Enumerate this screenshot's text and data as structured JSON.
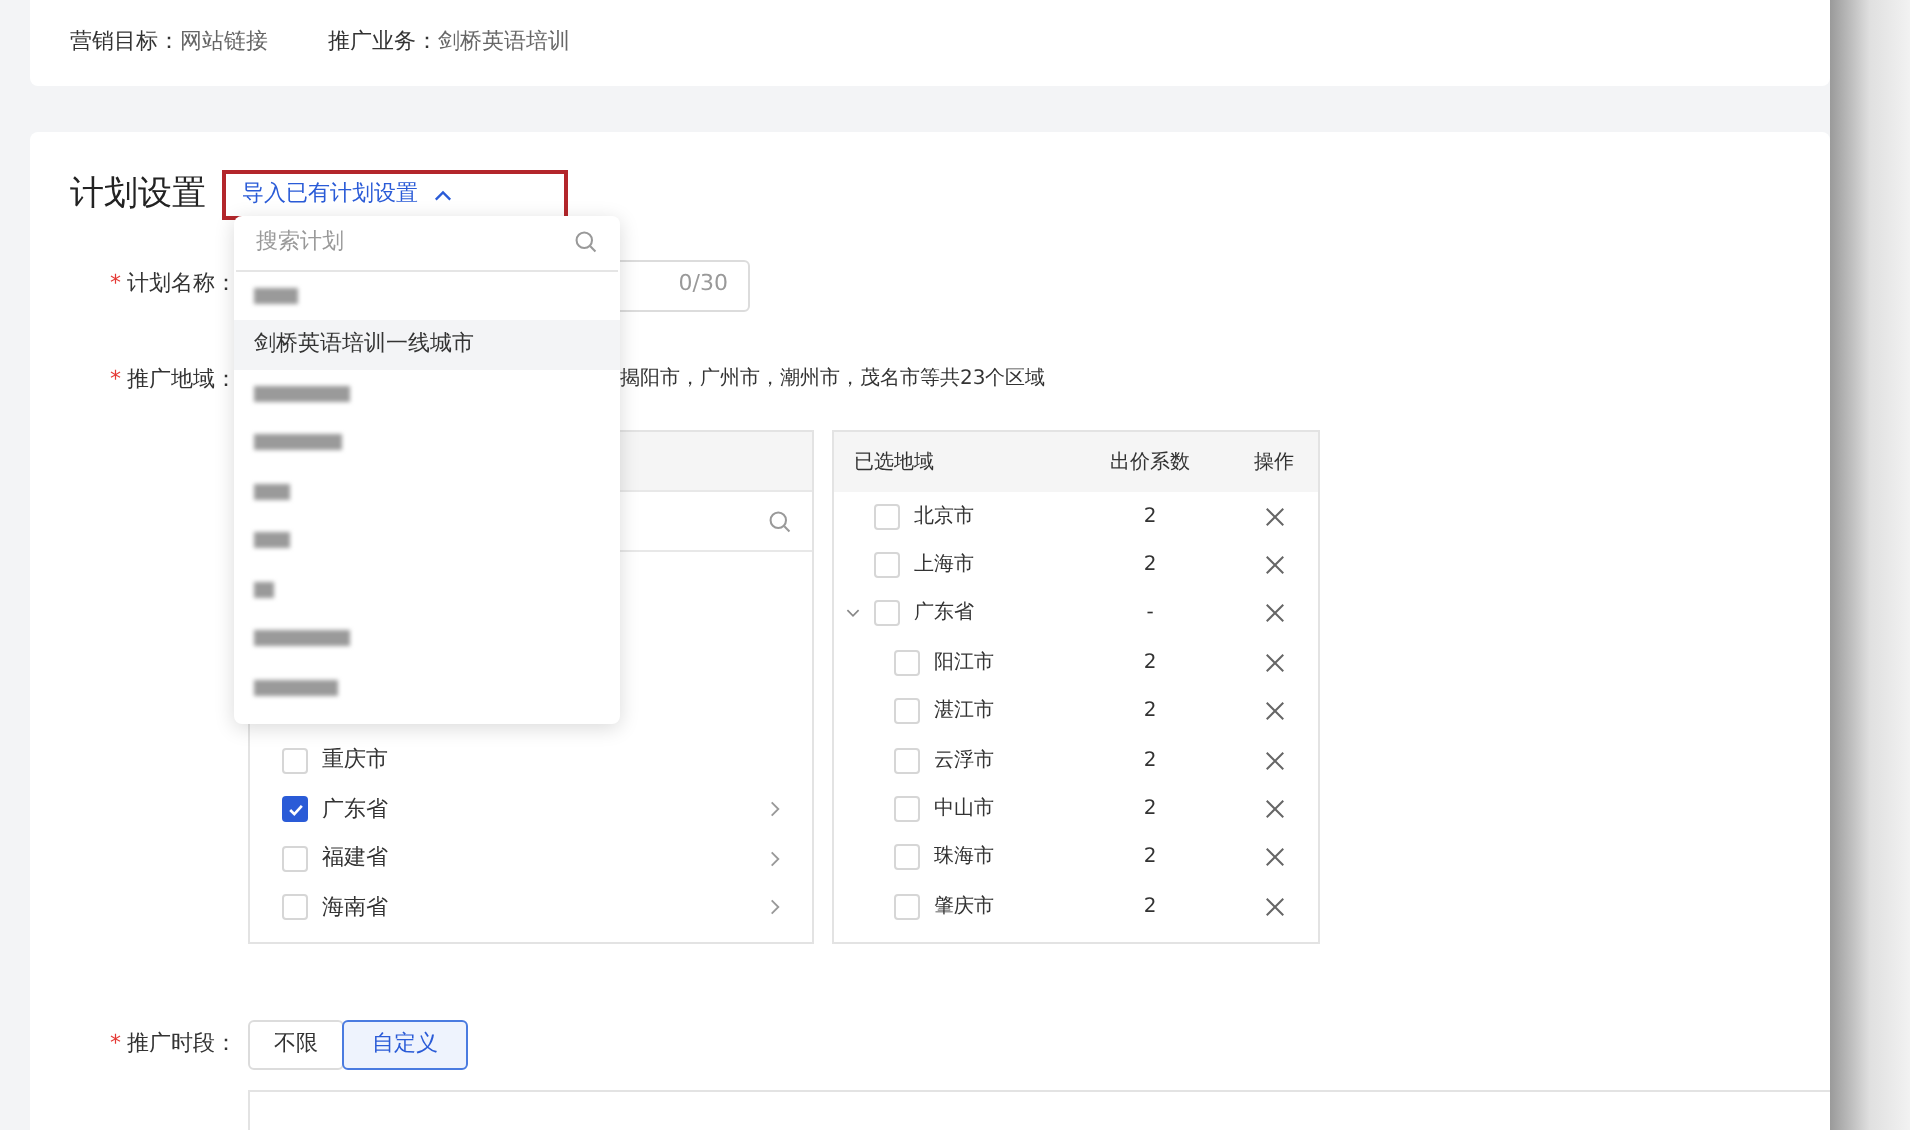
{
  "summary": [
    {
      "label": "营销目标：",
      "value": "网站链接"
    },
    {
      "label": "推广业务：",
      "value": "剑桥英语培训"
    }
  ],
  "plan_settings": {
    "title": "计划设置",
    "import_link": {
      "label": "导入已有计划设置",
      "expanded": true
    }
  },
  "import_dropdown": {
    "search": {
      "placeholder": "搜索计划"
    },
    "items": [
      {
        "kind": "redacted",
        "highlighted": false
      },
      {
        "kind": "text",
        "label": "剑桥英语培训一线城市",
        "highlighted": true
      },
      {
        "kind": "redacted",
        "highlighted": false
      },
      {
        "kind": "redacted",
        "highlighted": false
      },
      {
        "kind": "redacted",
        "highlighted": false
      },
      {
        "kind": "redacted",
        "highlighted": false
      },
      {
        "kind": "redacted",
        "highlighted": false
      },
      {
        "kind": "redacted",
        "highlighted": false
      },
      {
        "kind": "redacted",
        "highlighted": false
      }
    ]
  },
  "plan_name": {
    "required_mark": "*",
    "label": "计划名称：",
    "counter": "0/30"
  },
  "region": {
    "required_mark": "*",
    "label": "推广地域：",
    "summary": "揭阳市，广州市，潮州市，茂名市等共23个区域",
    "available": {
      "items": [
        {
          "label": "重庆市",
          "checked": false,
          "has_children": false
        },
        {
          "label": "广东省",
          "checked": true,
          "has_children": true
        },
        {
          "label": "福建省",
          "checked": false,
          "has_children": true
        },
        {
          "label": "海南省",
          "checked": false,
          "has_children": true
        }
      ]
    },
    "selected": {
      "columns": [
        "已选地域",
        "出价系数",
        "操作"
      ],
      "rows": [
        {
          "label": "北京市",
          "bid": "2",
          "checked": false
        },
        {
          "label": "上海市",
          "bid": "2",
          "checked": false
        },
        {
          "label": "广东省",
          "bid": "-",
          "checked": false,
          "expanded": true,
          "children": [
            {
              "label": "阳江市",
              "bid": "2",
              "checked": false
            },
            {
              "label": "湛江市",
              "bid": "2",
              "checked": false
            },
            {
              "label": "云浮市",
              "bid": "2",
              "checked": false
            },
            {
              "label": "中山市",
              "bid": "2",
              "checked": false
            },
            {
              "label": "珠海市",
              "bid": "2",
              "checked": false
            },
            {
              "label": "肇庆市",
              "bid": "2",
              "checked": false
            }
          ]
        }
      ]
    }
  },
  "schedule": {
    "required_mark": "*",
    "label": "推广时段：",
    "options": [
      {
        "label": "不限",
        "selected": false
      },
      {
        "label": "自定义",
        "selected": true
      }
    ]
  }
}
